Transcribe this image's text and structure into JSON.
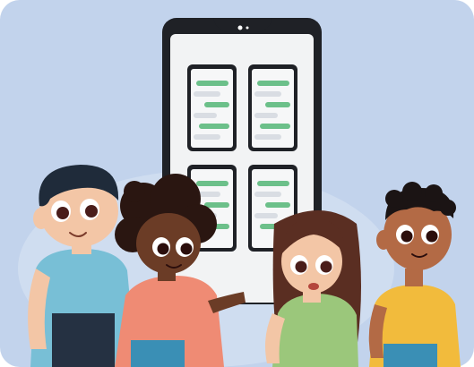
{
  "scene": {
    "description_icon": "illustration",
    "colors": {
      "background": "#c2d3ec",
      "background_light": "#dbe6f4",
      "phone_frame": "#1f2126",
      "phone_screen": "#f2f3f4",
      "chat_green": "#6cc08a",
      "chat_gray": "#d9dde3",
      "skin_light": "#f3c6a6",
      "skin_dark": "#6b3c26",
      "skin_brown": "#b36a45",
      "hair_dark": "#1f2b3a",
      "hair_brown": "#5a2e22",
      "shirt_blue": "#78bfd6",
      "shirt_salmon": "#ef8b74",
      "shirt_green": "#9bc77b",
      "shirt_yellow": "#f2bb3c"
    }
  }
}
